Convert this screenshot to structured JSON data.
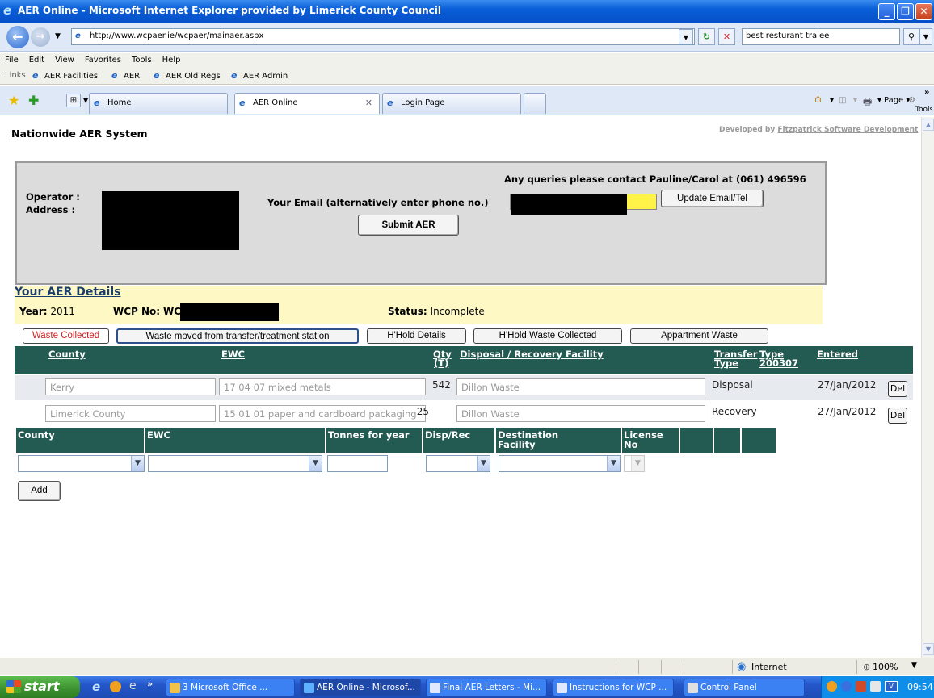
{
  "window": {
    "title": "AER Online - Microsoft Internet Explorer provided by Limerick County Council"
  },
  "addressbar": {
    "url": "http://www.wcpaer.ie/wcpaer/mainaer.aspx",
    "search_value": "best resturant tralee"
  },
  "menu": [
    "File",
    "Edit",
    "View",
    "Favorites",
    "Tools",
    "Help"
  ],
  "links": {
    "label": "Links",
    "items": [
      "AER Facilities",
      "AER",
      "AER Old Regs",
      "AER Admin"
    ]
  },
  "tabs": [
    {
      "label": "Home"
    },
    {
      "label": "AER Online"
    },
    {
      "label": "Login Page"
    }
  ],
  "commandbar": {
    "page": "Page",
    "tools": "Tools"
  },
  "page": {
    "system_name": "Nationwide AER System",
    "developed_by_prefix": "Developed by ",
    "developed_by_link": "Fitzpatrick Software Development",
    "queries": "Any queries please contact Pauline/Carol at (061) 496596",
    "operator_label": "Operator :",
    "address_label": "Address :",
    "email_label": "Your Email (alternatively enter phone no.)",
    "update_button": "Update Email/Tel",
    "submit_button": "Submit AER",
    "details_title": "Your AER Details",
    "year_label": "Year:",
    "year_value": "2011",
    "wcp_label": "WCP No:",
    "wcp_value": "WC",
    "status_label": "Status:",
    "status_value": "Incomplete"
  },
  "section_tabs": [
    "Waste Collected",
    "Waste moved from transfer/treatment station",
    "H'Hold Details",
    "H'Hold Waste Collected",
    "Appartment Waste"
  ],
  "table": {
    "headers": {
      "county": "County",
      "ewc": "EWC",
      "qty1": "Qty",
      "qty2": "(T)",
      "facility": "Disposal / Recovery Facility",
      "transfer1": "Transfer",
      "transfer2": "Type",
      "type1": "Type",
      "type2": "200307",
      "entered": "Entered"
    },
    "rows": [
      {
        "county": "Kerry",
        "ewc": "17 04 07 mixed metals",
        "qty": "542",
        "facility": "Dillon Waste",
        "type": "Disposal",
        "entered": "27/Jan/2012",
        "del": "Del"
      },
      {
        "county": "Limerick County",
        "ewc": "15 01 01 paper and cardboard packaging",
        "qty": "25",
        "facility": "Dillon Waste",
        "type": "Recovery",
        "entered": "27/Jan/2012",
        "del": "Del"
      }
    ]
  },
  "add_form": {
    "headers": {
      "county": "County",
      "ewc": "EWC",
      "tonnes": "Tonnes for year",
      "disp": "Disp/Rec",
      "dest1": "Destination",
      "dest2": "Facility",
      "lic1": "License",
      "lic2": "No"
    },
    "add_button": "Add"
  },
  "statusbar": {
    "zone": "Internet",
    "zoom": "100%"
  },
  "taskbar": {
    "start": "start",
    "tasks": [
      "3 Microsoft Office ...",
      "AER Online - Microsof...",
      "Final AER Letters - Mi...",
      "Instructions for WCP ...",
      "Control Panel"
    ],
    "clock": "09:54"
  }
}
